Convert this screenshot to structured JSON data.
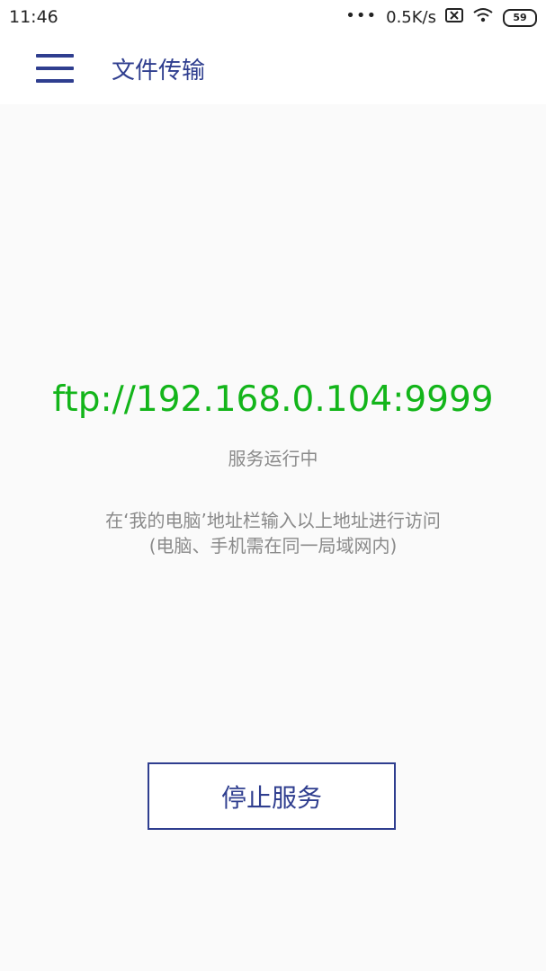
{
  "status_bar": {
    "time": "11:46",
    "network_speed": "0.5K/s",
    "battery": "59",
    "icons": [
      "more-dots-icon",
      "no-sim-icon",
      "wifi-icon",
      "battery-icon"
    ]
  },
  "app_bar": {
    "title": "文件传输",
    "menu_icon": "hamburger-menu-icon"
  },
  "main": {
    "ftp_address": "ftp://192.168.0.104:9999",
    "service_status": "服务运行中",
    "hint_line1": "在‘我的电脑’地址栏输入以上地址进行访问",
    "hint_line2": "(电脑、手机需在同一局域网内)",
    "stop_button_label": "停止服务"
  },
  "colors": {
    "accent": "#2f3e8f",
    "url_green": "#13b51a",
    "muted_text": "#8a8a8a",
    "background": "#fafafa"
  }
}
